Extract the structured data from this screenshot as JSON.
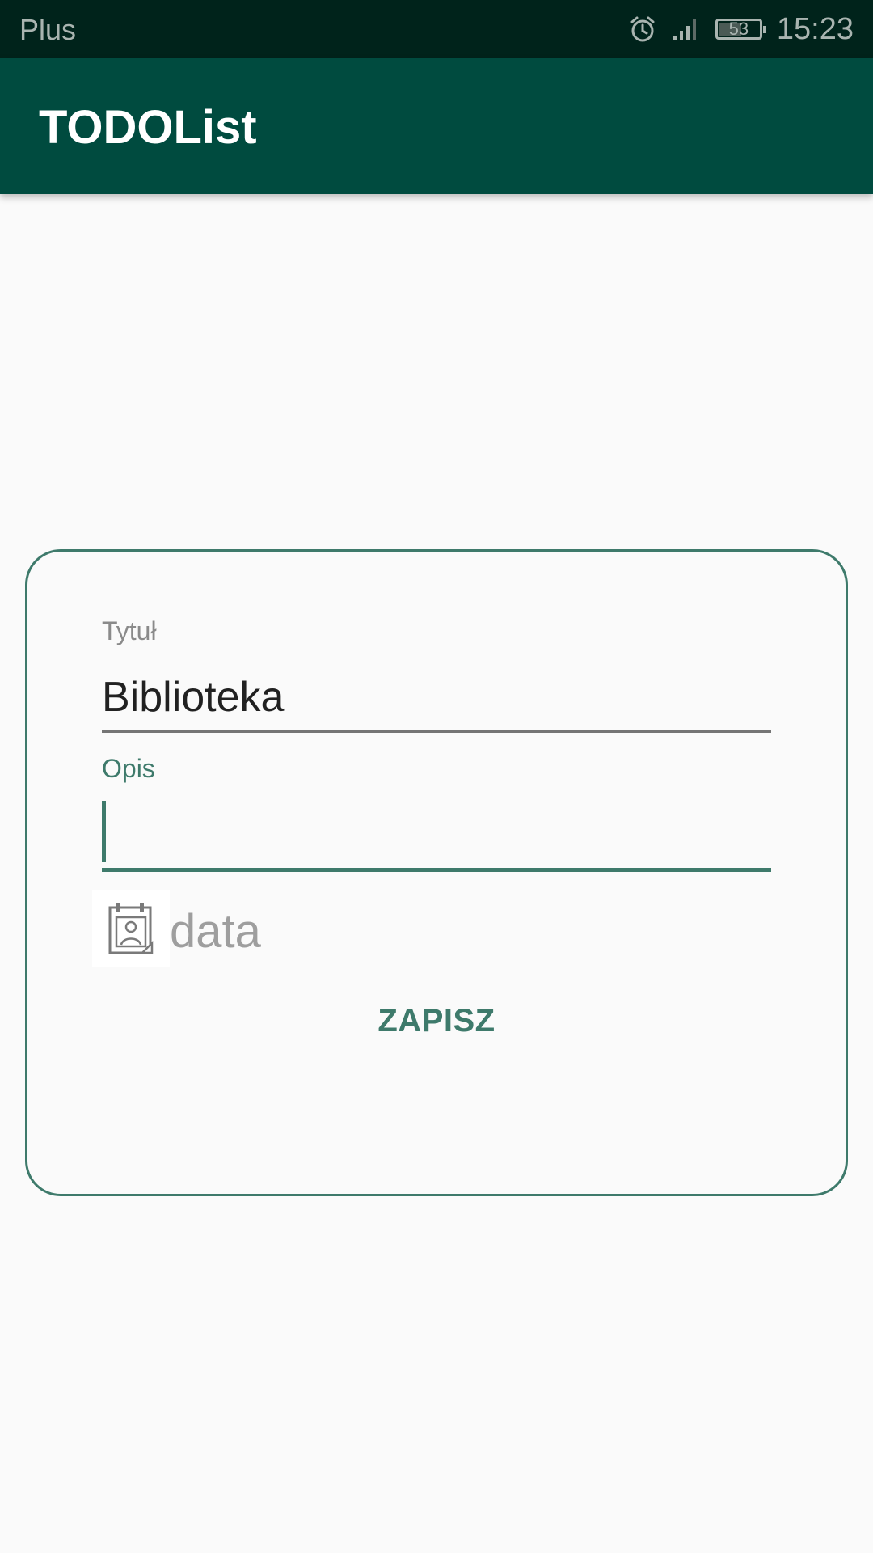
{
  "status_bar": {
    "carrier": "Plus",
    "battery_level": "53",
    "time": "15:23",
    "icons": [
      "alarm-icon",
      "signal-icon",
      "battery-icon"
    ]
  },
  "app_bar": {
    "title": "TODOList"
  },
  "form": {
    "title_label": "Tytuł",
    "title_value": "Biblioteka",
    "description_label": "Opis",
    "description_value": "",
    "date_icon": "calendar-icon",
    "date_placeholder": "data",
    "save_label": "ZAPISZ"
  },
  "colors": {
    "status_bar": "#00231b",
    "app_bar": "#004b3f",
    "accent": "#3e7a6b",
    "background": "#fafafa"
  }
}
